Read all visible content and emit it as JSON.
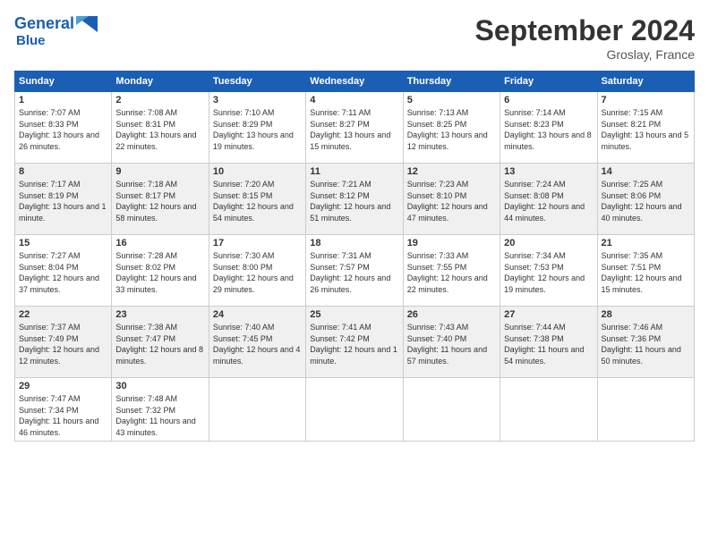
{
  "logo": {
    "general": "General",
    "blue": "Blue"
  },
  "title": "September 2024",
  "location": "Groslay, France",
  "headers": [
    "Sunday",
    "Monday",
    "Tuesday",
    "Wednesday",
    "Thursday",
    "Friday",
    "Saturday"
  ],
  "rows": [
    [
      {
        "day": "1",
        "sunrise": "Sunrise: 7:07 AM",
        "sunset": "Sunset: 8:33 PM",
        "daylight": "Daylight: 13 hours and 26 minutes."
      },
      {
        "day": "2",
        "sunrise": "Sunrise: 7:08 AM",
        "sunset": "Sunset: 8:31 PM",
        "daylight": "Daylight: 13 hours and 22 minutes."
      },
      {
        "day": "3",
        "sunrise": "Sunrise: 7:10 AM",
        "sunset": "Sunset: 8:29 PM",
        "daylight": "Daylight: 13 hours and 19 minutes."
      },
      {
        "day": "4",
        "sunrise": "Sunrise: 7:11 AM",
        "sunset": "Sunset: 8:27 PM",
        "daylight": "Daylight: 13 hours and 15 minutes."
      },
      {
        "day": "5",
        "sunrise": "Sunrise: 7:13 AM",
        "sunset": "Sunset: 8:25 PM",
        "daylight": "Daylight: 13 hours and 12 minutes."
      },
      {
        "day": "6",
        "sunrise": "Sunrise: 7:14 AM",
        "sunset": "Sunset: 8:23 PM",
        "daylight": "Daylight: 13 hours and 8 minutes."
      },
      {
        "day": "7",
        "sunrise": "Sunrise: 7:15 AM",
        "sunset": "Sunset: 8:21 PM",
        "daylight": "Daylight: 13 hours and 5 minutes."
      }
    ],
    [
      {
        "day": "8",
        "sunrise": "Sunrise: 7:17 AM",
        "sunset": "Sunset: 8:19 PM",
        "daylight": "Daylight: 13 hours and 1 minute."
      },
      {
        "day": "9",
        "sunrise": "Sunrise: 7:18 AM",
        "sunset": "Sunset: 8:17 PM",
        "daylight": "Daylight: 12 hours and 58 minutes."
      },
      {
        "day": "10",
        "sunrise": "Sunrise: 7:20 AM",
        "sunset": "Sunset: 8:15 PM",
        "daylight": "Daylight: 12 hours and 54 minutes."
      },
      {
        "day": "11",
        "sunrise": "Sunrise: 7:21 AM",
        "sunset": "Sunset: 8:12 PM",
        "daylight": "Daylight: 12 hours and 51 minutes."
      },
      {
        "day": "12",
        "sunrise": "Sunrise: 7:23 AM",
        "sunset": "Sunset: 8:10 PM",
        "daylight": "Daylight: 12 hours and 47 minutes."
      },
      {
        "day": "13",
        "sunrise": "Sunrise: 7:24 AM",
        "sunset": "Sunset: 8:08 PM",
        "daylight": "Daylight: 12 hours and 44 minutes."
      },
      {
        "day": "14",
        "sunrise": "Sunrise: 7:25 AM",
        "sunset": "Sunset: 8:06 PM",
        "daylight": "Daylight: 12 hours and 40 minutes."
      }
    ],
    [
      {
        "day": "15",
        "sunrise": "Sunrise: 7:27 AM",
        "sunset": "Sunset: 8:04 PM",
        "daylight": "Daylight: 12 hours and 37 minutes."
      },
      {
        "day": "16",
        "sunrise": "Sunrise: 7:28 AM",
        "sunset": "Sunset: 8:02 PM",
        "daylight": "Daylight: 12 hours and 33 minutes."
      },
      {
        "day": "17",
        "sunrise": "Sunrise: 7:30 AM",
        "sunset": "Sunset: 8:00 PM",
        "daylight": "Daylight: 12 hours and 29 minutes."
      },
      {
        "day": "18",
        "sunrise": "Sunrise: 7:31 AM",
        "sunset": "Sunset: 7:57 PM",
        "daylight": "Daylight: 12 hours and 26 minutes."
      },
      {
        "day": "19",
        "sunrise": "Sunrise: 7:33 AM",
        "sunset": "Sunset: 7:55 PM",
        "daylight": "Daylight: 12 hours and 22 minutes."
      },
      {
        "day": "20",
        "sunrise": "Sunrise: 7:34 AM",
        "sunset": "Sunset: 7:53 PM",
        "daylight": "Daylight: 12 hours and 19 minutes."
      },
      {
        "day": "21",
        "sunrise": "Sunrise: 7:35 AM",
        "sunset": "Sunset: 7:51 PM",
        "daylight": "Daylight: 12 hours and 15 minutes."
      }
    ],
    [
      {
        "day": "22",
        "sunrise": "Sunrise: 7:37 AM",
        "sunset": "Sunset: 7:49 PM",
        "daylight": "Daylight: 12 hours and 12 minutes."
      },
      {
        "day": "23",
        "sunrise": "Sunrise: 7:38 AM",
        "sunset": "Sunset: 7:47 PM",
        "daylight": "Daylight: 12 hours and 8 minutes."
      },
      {
        "day": "24",
        "sunrise": "Sunrise: 7:40 AM",
        "sunset": "Sunset: 7:45 PM",
        "daylight": "Daylight: 12 hours and 4 minutes."
      },
      {
        "day": "25",
        "sunrise": "Sunrise: 7:41 AM",
        "sunset": "Sunset: 7:42 PM",
        "daylight": "Daylight: 12 hours and 1 minute."
      },
      {
        "day": "26",
        "sunrise": "Sunrise: 7:43 AM",
        "sunset": "Sunset: 7:40 PM",
        "daylight": "Daylight: 11 hours and 57 minutes."
      },
      {
        "day": "27",
        "sunrise": "Sunrise: 7:44 AM",
        "sunset": "Sunset: 7:38 PM",
        "daylight": "Daylight: 11 hours and 54 minutes."
      },
      {
        "day": "28",
        "sunrise": "Sunrise: 7:46 AM",
        "sunset": "Sunset: 7:36 PM",
        "daylight": "Daylight: 11 hours and 50 minutes."
      }
    ],
    [
      {
        "day": "29",
        "sunrise": "Sunrise: 7:47 AM",
        "sunset": "Sunset: 7:34 PM",
        "daylight": "Daylight: 11 hours and 46 minutes."
      },
      {
        "day": "30",
        "sunrise": "Sunrise: 7:48 AM",
        "sunset": "Sunset: 7:32 PM",
        "daylight": "Daylight: 11 hours and 43 minutes."
      },
      null,
      null,
      null,
      null,
      null
    ]
  ]
}
